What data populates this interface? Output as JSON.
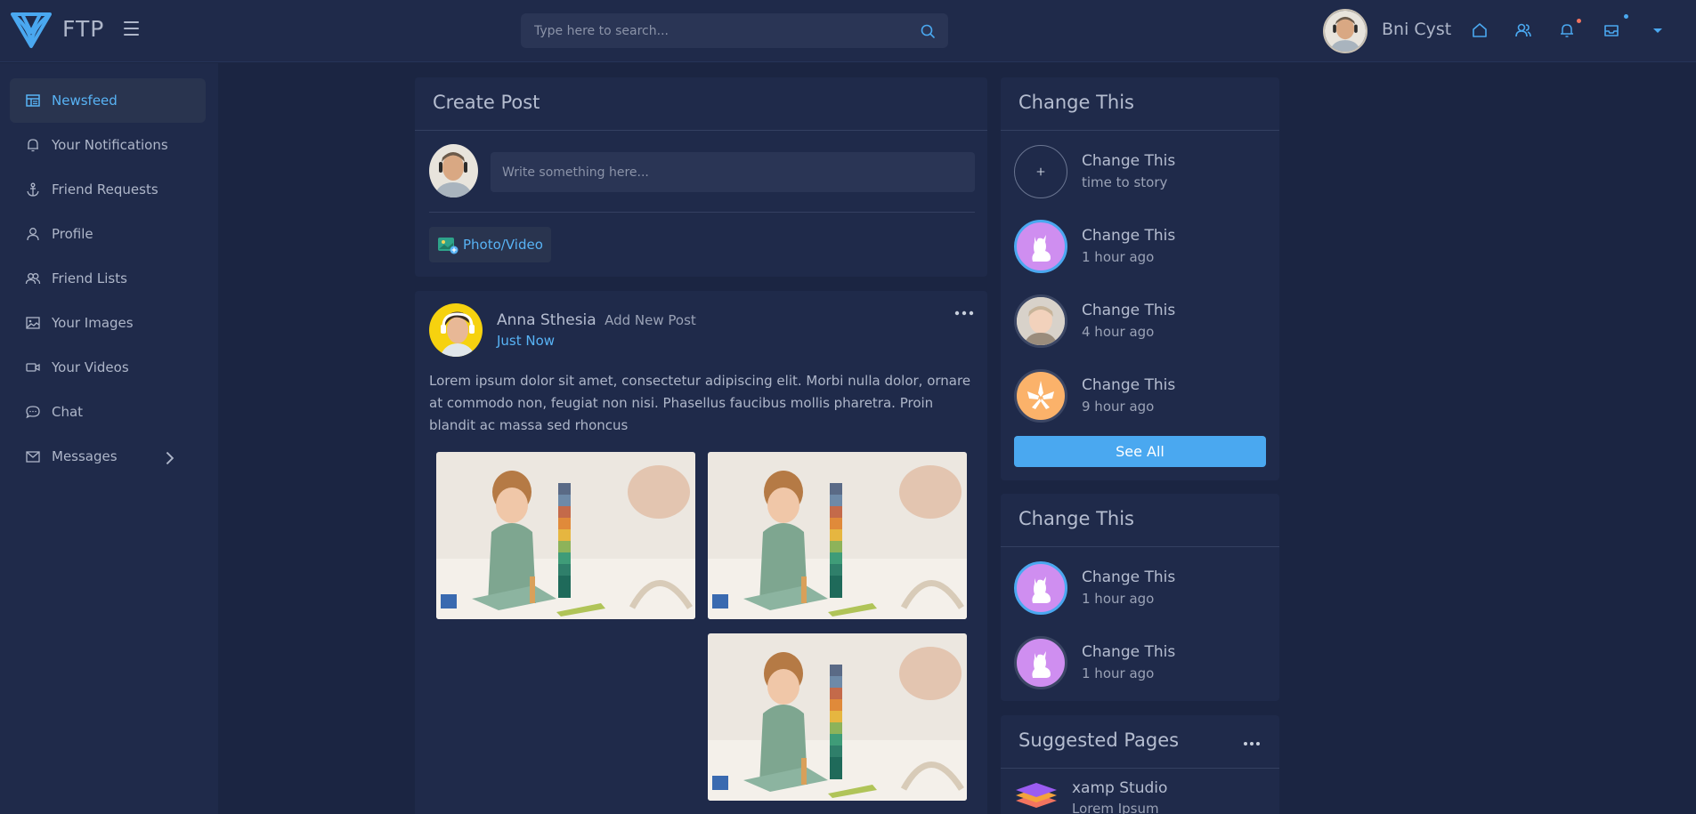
{
  "header": {
    "logo_text": "FTP",
    "search_placeholder": "Type here to search...",
    "user_name": "Bni Cyst"
  },
  "sidebar": {
    "items": [
      {
        "label": "Newsfeed",
        "icon": "newsfeed-icon",
        "active": true
      },
      {
        "label": "Your Notifications",
        "icon": "bell-icon"
      },
      {
        "label": "Friend Requests",
        "icon": "anchor-icon"
      },
      {
        "label": "Profile",
        "icon": "user-icon"
      },
      {
        "label": "Friend Lists",
        "icon": "users-icon"
      },
      {
        "label": "Your Images",
        "icon": "image-icon"
      },
      {
        "label": "Your Videos",
        "icon": "video-icon"
      },
      {
        "label": "Chat",
        "icon": "chat-icon"
      },
      {
        "label": "Messages",
        "icon": "mail-icon"
      }
    ]
  },
  "create_post": {
    "title": "Create Post",
    "input_placeholder": "Write something here...",
    "photo_button": "Photo/Video"
  },
  "post": {
    "author": "Anna Sthesia",
    "action": "Add New Post",
    "time": "Just Now",
    "text": "Lorem ipsum dolor sit amet, consectetur adipiscing elit. Morbi nulla dolor, ornare at commodo non, feugiat non nisi. Phasellus faucibus mollis pharetra. Proin blandit ac massa sed rhoncus"
  },
  "stories": {
    "title": "Change This",
    "items": [
      {
        "name": "Change This",
        "sub": "time to story"
      },
      {
        "name": "Change This",
        "sub": "1 hour ago"
      },
      {
        "name": "Change This",
        "sub": "4 hour ago"
      },
      {
        "name": "Change This",
        "sub": "9 hour ago"
      }
    ],
    "see_all": "See All"
  },
  "change_this": {
    "title": "Change This",
    "items": [
      {
        "name": "Change This",
        "sub": "1 hour ago"
      },
      {
        "name": "Change This",
        "sub": "1 hour ago"
      }
    ]
  },
  "suggested_pages": {
    "title": "Suggested Pages",
    "items": [
      {
        "name": "xamp Studio",
        "sub": "Lorem Ipsum"
      }
    ]
  },
  "colors": {
    "background": "#1b2542",
    "panel": "#1f2a4a",
    "accent": "#58b3f5",
    "button": "#4aa8f0",
    "notification_dot": "#f2745f"
  }
}
